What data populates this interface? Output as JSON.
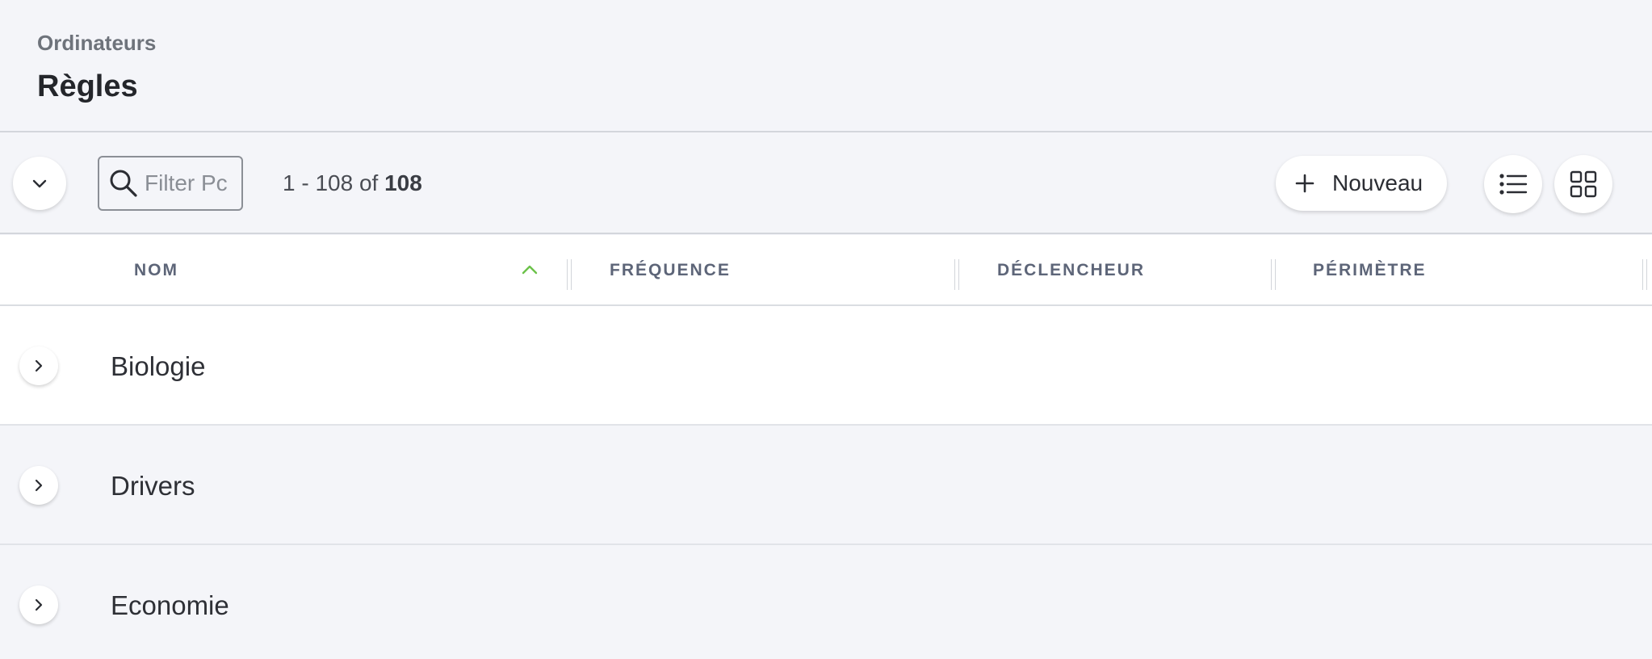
{
  "header": {
    "breadcrumb": "Ordinateurs",
    "title": "Règles"
  },
  "toolbar": {
    "search_placeholder": "Filter Pc",
    "count_range": "1 - 108 of ",
    "count_total": "108",
    "new_label": "Nouveau"
  },
  "table": {
    "columns": [
      "NOM",
      "FRÉQUENCE",
      "DÉCLENCHEUR",
      "PÉRIMÈTRE"
    ],
    "sorted_column": "NOM",
    "sort_direction": "ascending",
    "rows": [
      {
        "label": "Biologie"
      },
      {
        "label": "Drivers"
      },
      {
        "label": "Economie"
      }
    ]
  },
  "colors": {
    "background": "#f4f5f9",
    "sort_accent": "#6cc24a",
    "header_text": "#5d6578"
  },
  "icons": {
    "collapse": "chevron-down-icon",
    "search": "search-icon",
    "add": "plus-icon",
    "list_view": "list-view-icon",
    "grid_view": "grid-view-icon",
    "sort": "chevron-up-icon",
    "expand": "chevron-right-icon"
  }
}
